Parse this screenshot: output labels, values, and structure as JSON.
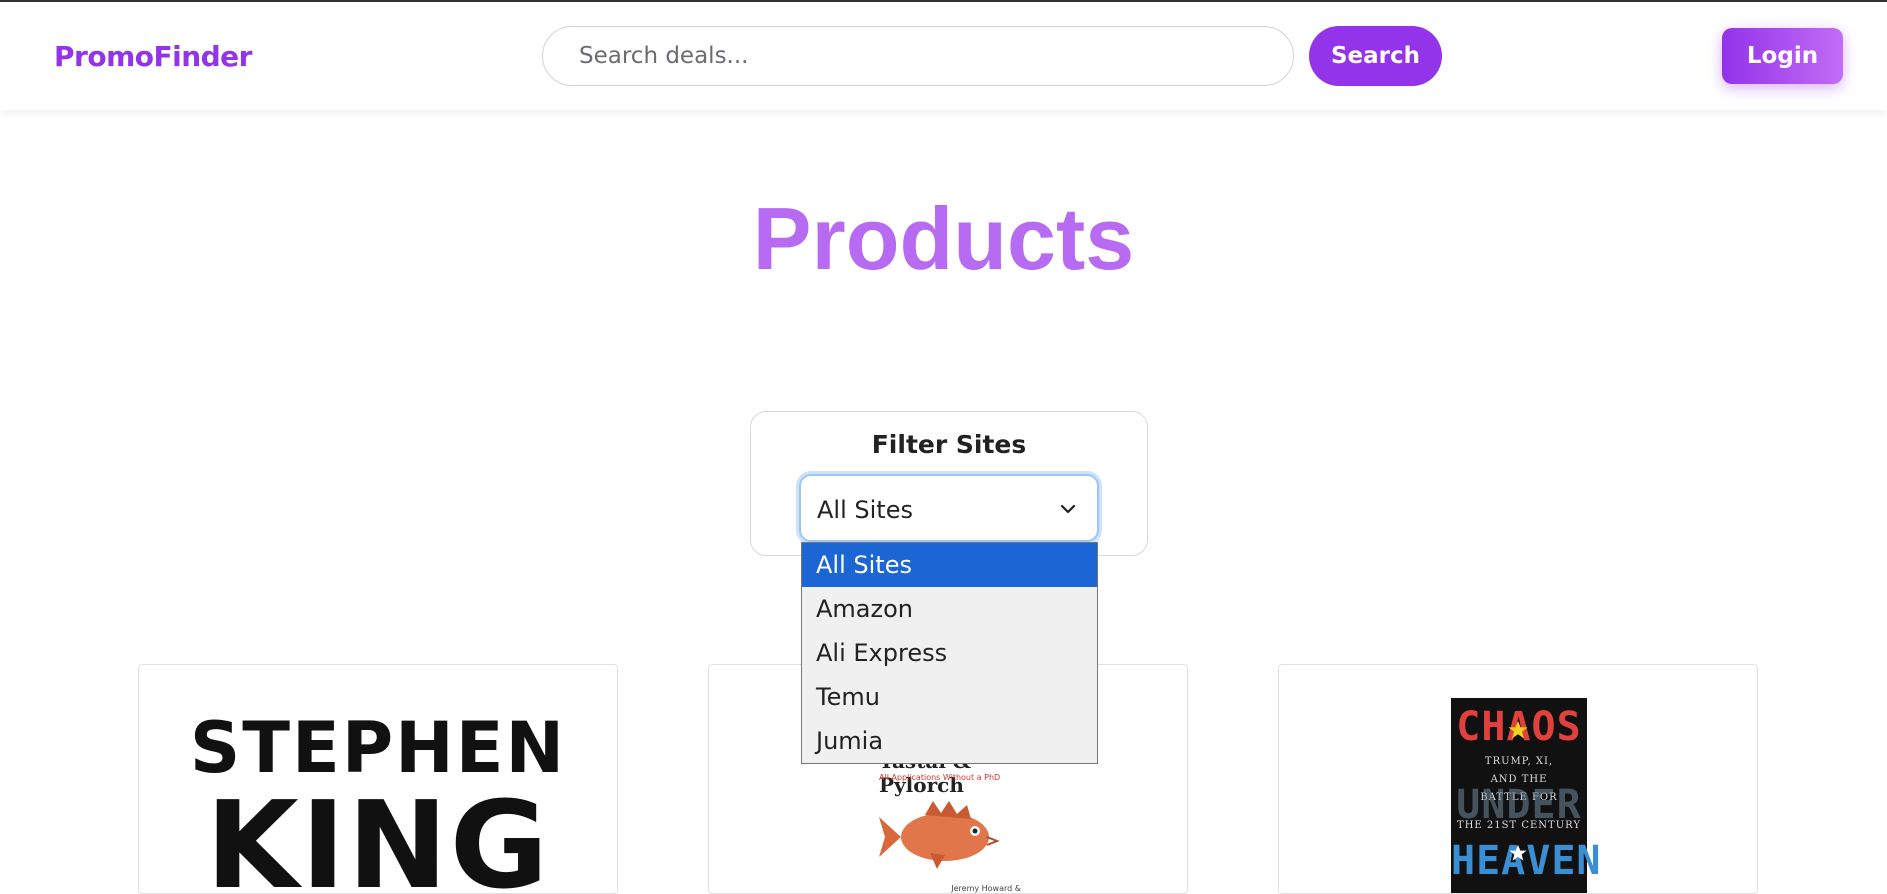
{
  "header": {
    "brand": "PromoFinder",
    "search_placeholder": "Search deals...",
    "search_value": "",
    "search_button": "Search",
    "login_button": "Login"
  },
  "main": {
    "title": "Products"
  },
  "filter": {
    "title": "Filter Sites",
    "selected": "All Sites",
    "options": [
      "All Sites",
      "Amazon",
      "Ali Express",
      "Temu",
      "Jumia"
    ]
  },
  "products": [
    {
      "cover_line1": "STEPHEN",
      "cover_line2": "KING"
    },
    {
      "cover_title": "Tastal & Pylorch",
      "cover_subtitle": "All Applications Without a PhD",
      "cover_author": "Jeremy Howard &"
    },
    {
      "cover_line1": "CHAOS",
      "cover_line2": "TRUMP, XI,",
      "cover_line3": "AND THE",
      "cover_line4": "BATTLE FOR",
      "cover_line5": "UNDER",
      "cover_line6": "THE 21ST CENTURY",
      "cover_line7": "HEAVEN"
    }
  ],
  "colors": {
    "brand": "#9333ea",
    "title": "#b66bf2",
    "selected_option": "#1b66d4"
  }
}
